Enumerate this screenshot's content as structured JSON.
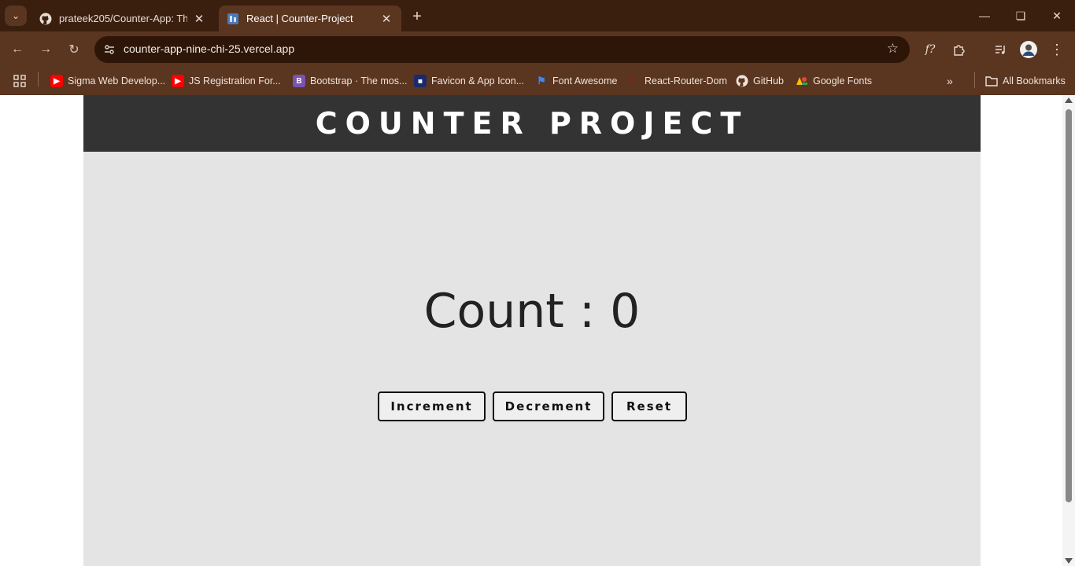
{
  "browser": {
    "tabs": [
      {
        "title": "prateek205/Counter-App: This",
        "icon": "github-icon"
      },
      {
        "title": "React | Counter-Project",
        "icon": "react-favicon-icon"
      }
    ],
    "new_tab_glyph": "+",
    "url": "counter-app-nine-chi-25.vercel.app",
    "bookmarks": [
      {
        "label": "Sigma Web Develop...",
        "icon": "youtube-icon",
        "color": "#ff0000"
      },
      {
        "label": "JS Registration For...",
        "icon": "youtube-icon",
        "color": "#ff0000"
      },
      {
        "label": "Bootstrap · The mos...",
        "icon": "bootstrap-icon",
        "color": "#7952b3"
      },
      {
        "label": "Favicon & App Icon...",
        "icon": "favicon-generator-icon",
        "color": "#1a2a6c"
      },
      {
        "label": "Font Awesome",
        "icon": "font-awesome-flag-icon",
        "color": "#3e86f5"
      },
      {
        "label": "React-Router-Dom",
        "icon": "react-router-icon",
        "color": "#d0021b"
      },
      {
        "label": "GitHub",
        "icon": "github-icon",
        "color": "#ffffff"
      },
      {
        "label": "Google Fonts",
        "icon": "google-fonts-icon",
        "color": "#4285f4"
      }
    ],
    "all_bookmarks_label": "All Bookmarks"
  },
  "app": {
    "title": "COUNTER PROJECT",
    "count_label": "Count : 0",
    "buttons": {
      "increment": "Increment",
      "decrement": "Decrement",
      "reset": "Reset"
    }
  },
  "colors": {
    "header_bg": "#333333",
    "app_bg": "#e4e4e4",
    "chrome_dark": "#3a1f0f",
    "chrome_toolbar": "#5a3520"
  }
}
